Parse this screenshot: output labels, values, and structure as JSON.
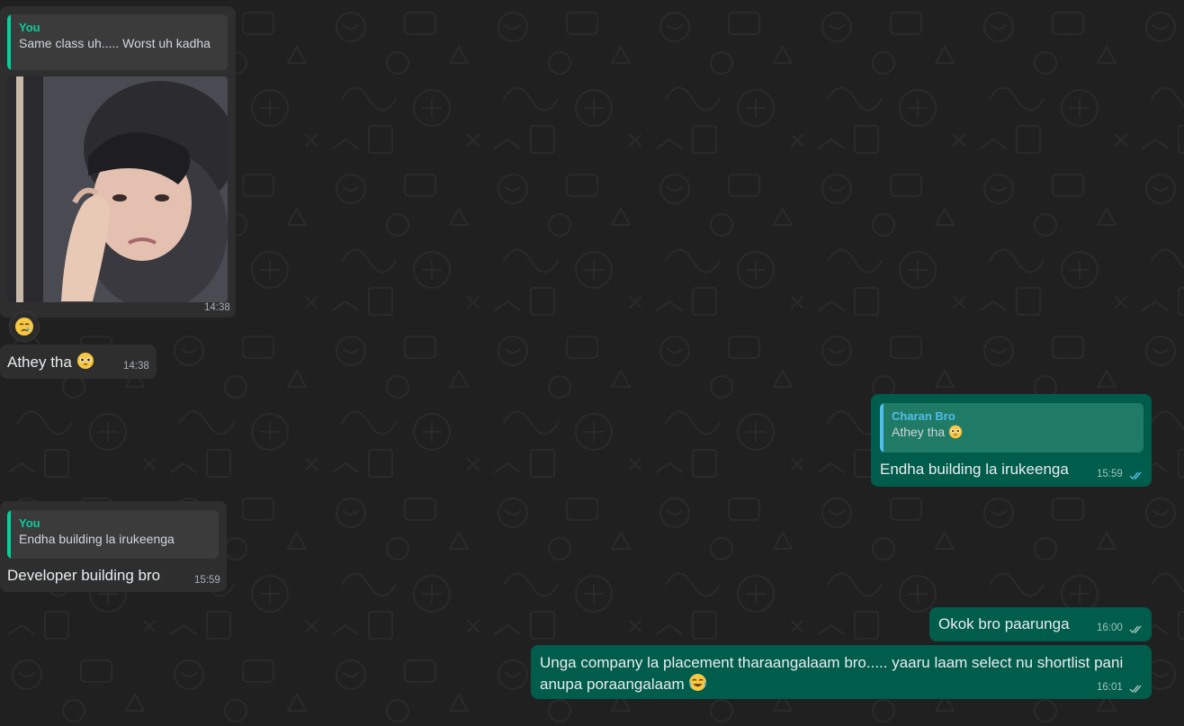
{
  "messages": [
    {
      "id": "m1",
      "direction": "incoming",
      "quote": {
        "author": "You",
        "text": "Same class uh..... Worst uh kadha"
      },
      "media": "crying-child-photo",
      "time": "14:38"
    },
    {
      "id": "m2",
      "direction": "incoming",
      "text": "Athey tha",
      "emoji": "pleading-face",
      "time": "14:38",
      "reaction": "crying-face"
    },
    {
      "id": "m3",
      "direction": "outgoing",
      "quote": {
        "author": "Charan Bro",
        "text": "Athey tha"
      },
      "text": "Endha building la irukeenga",
      "time": "15:59",
      "status": "read"
    },
    {
      "id": "m4",
      "direction": "incoming",
      "quote": {
        "author": "You",
        "text": "Endha building la irukeenga"
      },
      "text": "Developer building bro",
      "time": "15:59"
    },
    {
      "id": "m5",
      "direction": "outgoing",
      "text": "Okok bro paarunga",
      "time": "16:00",
      "status": "read"
    },
    {
      "id": "m6",
      "direction": "outgoing",
      "text_line1": "Unga company la placement tharaangalaam bro..... yaaru laam select nu shortlist pani",
      "text_line2": "anupa poraangalaam",
      "emoji": "tears-of-joy-face",
      "time": "16:01",
      "status": "read"
    }
  ],
  "colors": {
    "background": "#202020",
    "incoming_bubble": "#2e2e2e",
    "outgoing_bubble": "#005c4b",
    "quote_you_bar": "#06cf9c",
    "quote_contact_bar": "#53bdeb",
    "read_ticks": "#53bdeb"
  }
}
